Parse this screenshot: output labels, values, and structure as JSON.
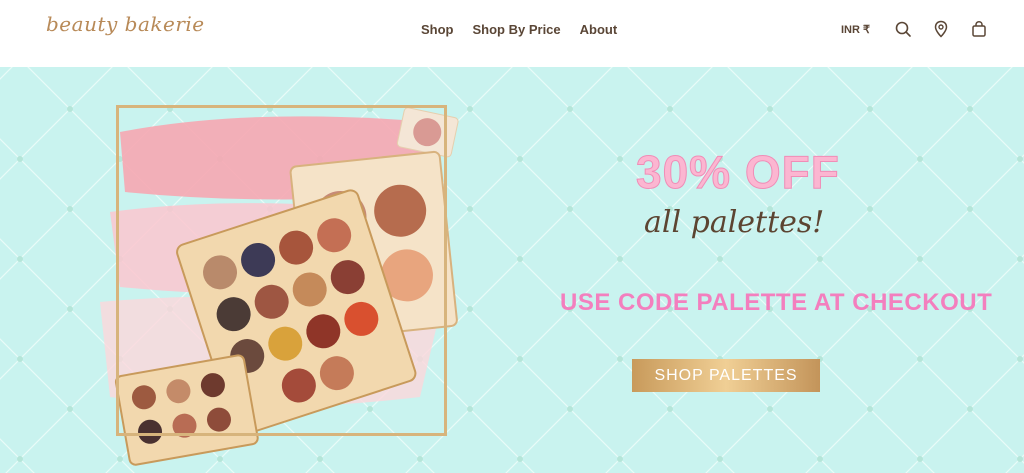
{
  "brand": {
    "logo_text": "beauty bakerie"
  },
  "nav": {
    "items": [
      "Shop",
      "Shop By Price",
      "About"
    ]
  },
  "utility": {
    "currency": "INR ₹"
  },
  "hero": {
    "discount": "30% OFF",
    "script": "all palettes!",
    "code_text": "USE CODE PALETTE AT CHECKOUT",
    "cta_label": "SHOP PALETTES"
  },
  "colors": {
    "hero_bg": "#c9f3ef",
    "accent_pink": "#f37fbe",
    "gold": "#d7b47c",
    "brown_text": "#5a4636"
  },
  "icons": [
    "search-icon",
    "location-pin-icon",
    "shopping-bag-icon"
  ]
}
